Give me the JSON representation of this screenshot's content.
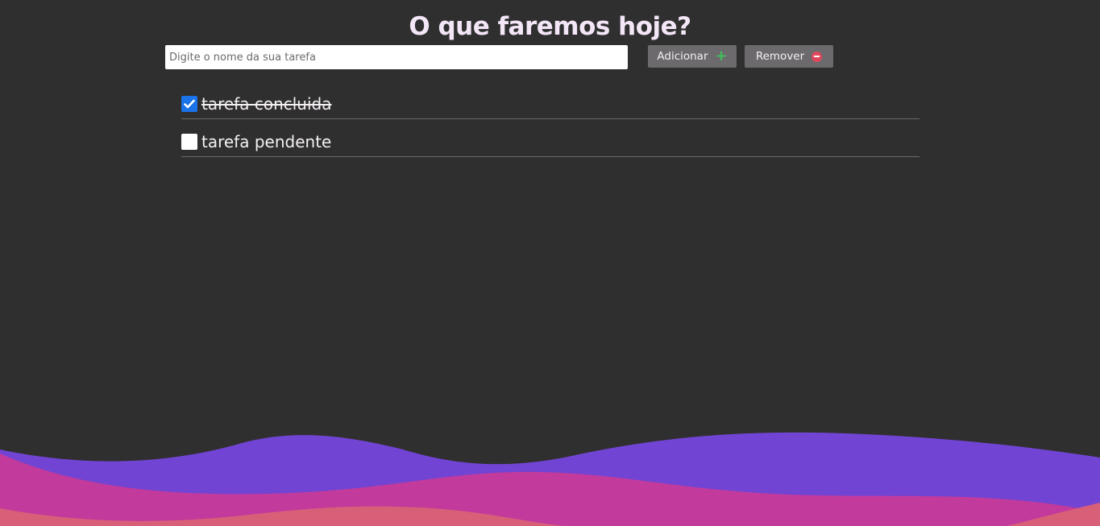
{
  "header": {
    "title": "O que faremos hoje?"
  },
  "form": {
    "input_placeholder": "Digite o nome da sua tarefa",
    "input_value": "",
    "add_label": "Adicionar",
    "add_icon": "plus-icon",
    "remove_label": "Remover",
    "remove_icon": "minus-circle-icon"
  },
  "tasks": [
    {
      "label": "tarefa concluida",
      "done": true
    },
    {
      "label": "tarefa pendente",
      "done": false
    }
  ],
  "colors": {
    "background": "#2f2f2f",
    "title": "#f3e6f7",
    "button_bg": "#6c6a6c",
    "plus": "#3fbf5a",
    "minus": "#e0475d",
    "checkbox_checked": "#1a73e8",
    "wave_purple": "#7244d4",
    "wave_magenta": "#c23a9c",
    "wave_coral": "#d85f78"
  }
}
